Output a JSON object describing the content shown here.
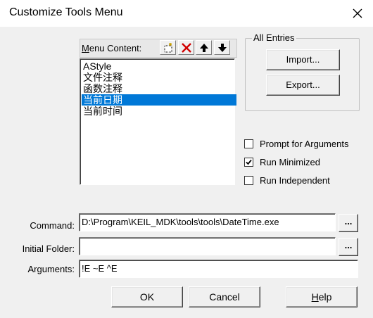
{
  "window": {
    "title": "Customize Tools Menu"
  },
  "menu_content": {
    "label_first": "M",
    "label_rest": "enu Content:",
    "toolbar_icons": [
      "new-item-icon",
      "delete-icon",
      "move-up-icon",
      "move-down-icon"
    ],
    "items": [
      "AStyle",
      "文件注释",
      "函数注释",
      "当前日期",
      "当前时间"
    ],
    "selected_index": 3
  },
  "all_entries": {
    "title": "All Entries",
    "import_label": "Import...",
    "export_label": "Export..."
  },
  "options": {
    "prompt_label": "Prompt for  Arguments",
    "prompt_checked": false,
    "run_minimized_label": "Run Minimized",
    "run_minimized_checked": true,
    "run_independent_label": "Run Independent",
    "run_independent_checked": false
  },
  "fields": {
    "command_label": "Command:",
    "command_value": "D:\\Program\\KEIL_MDK\\tools\\tools\\DateTime.exe",
    "initial_folder_label": "Initial Folder:",
    "initial_folder_value": "",
    "arguments_label": "Arguments:",
    "arguments_value": "!E ~E ^E",
    "browse_label": "..."
  },
  "buttons": {
    "ok": "OK",
    "cancel": "Cancel",
    "help_first": "H",
    "help_rest": "elp"
  },
  "colors": {
    "selection": "#0078d7",
    "delete_icon": "#d00000"
  }
}
